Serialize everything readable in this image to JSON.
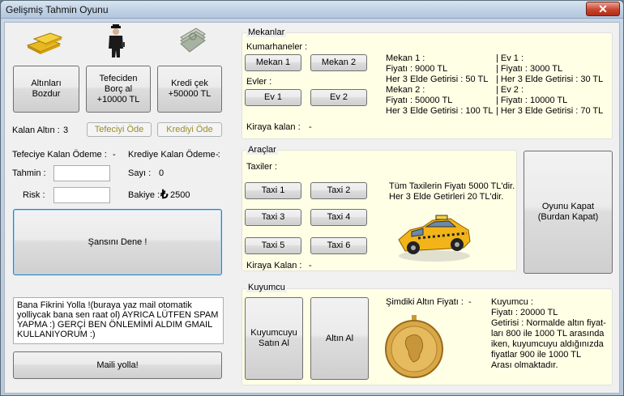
{
  "window": {
    "title": "Gelişmiş Tahmin Oyunu",
    "close_glyph": "✕"
  },
  "left": {
    "buttons": {
      "altin_bozdur": "Altınları\nBozdur",
      "tefeci_borc": "Tefeciden\nBorç al\n+10000 TL",
      "kredi_cek": "Kredi çek\n+50000 TL"
    },
    "kalan_altin_label": "Kalan Altın :",
    "kalan_altin_value": "3",
    "tefeciyi_ode": "Tefeciyi Öde",
    "krediyi_ode": "Krediyi Öde",
    "tefeciye_kalan": "Tefeciye Kalan Ödeme :",
    "tefeciye_kalan_value": "-",
    "krediye_kalan": "Krediye Kalan Ödeme :",
    "krediye_kalan_value": "-",
    "tahmin_label": "Tahmin :",
    "sayi_label": "Sayı :",
    "sayi_value": "0",
    "risk_label": "Risk :",
    "bakiye_label": "Bakiye :",
    "bakiye_symbol": "₺",
    "bakiye_value": "2500",
    "sansini_dene": "Şansını Dene !",
    "feedback_text": "Bana Fikrini Yolla !(buraya yaz mail otomatik yolliycak bana sen raat ol) AYRICA LÜTFEN SPAM YAPMA :) GERÇİ BEN ÖNLEMİMİ ALDIM GMAIL KULLANIYORUM :)",
    "maili_yolla": "Maili yolla!"
  },
  "mekanlar": {
    "legend": "Mekanlar",
    "kumarhaneler": "Kumarhaneler :",
    "mekan1": "Mekan 1",
    "mekan2": "Mekan 2",
    "evler": "Evler :",
    "ev1": "Ev 1",
    "ev2": "Ev 2",
    "kiraya_kalan": "Kiraya kalan :",
    "kiraya_kalan_value": "-",
    "info_mekan": "Mekan 1 :\nFiyatı : 9000 TL\nHer 3 Elde Getirisi :  50 TL\nMekan 2 :\nFiyatı : 50000 TL\nHer 3 Elde Getirisi : 100 TL",
    "info_ev": "| Ev 1 :\n| Fiyatı : 3000 TL\n| Her 3 Elde Getirisi : 30 TL\n| Ev 2 :\n| Fiyatı : 10000 TL\n| Her 3 Elde Getirisi : 70 TL"
  },
  "araclar": {
    "legend": "Araçlar",
    "taxiler": "Taxiler :",
    "taxi": [
      "Taxi 1",
      "Taxi 2",
      "Taxi 3",
      "Taxi 4",
      "Taxi 5",
      "Taxi 6"
    ],
    "info": "Tüm Taxilerin Fiyatı 5000 TL'dir.\nHer 3 Elde Getirleri 20 TL'dir.",
    "kiraya_kalan": "Kiraya Kalan :",
    "kiraya_kalan_value": "-"
  },
  "oyunu_kapat": "Oyunu Kapat\n(Burdan Kapat)",
  "kuyumcu": {
    "legend": "Kuyumcu",
    "satin_al": "Kuyumcuyu\nSatın Al",
    "altin_al": "Altın Al",
    "simdiki_fiyat": "Şimdiki Altın Fiyatı :",
    "simdiki_fiyat_value": "-",
    "info": "Kuyumcu :\nFiyatı : 20000 TL\nGetirisi : Normalde altın fiyat-\nları 800 ile 1000 TL arasında\niken, kuyumcuyu aldığınızda\nfiyatlar 900 ile 1000 TL\nArası olmaktadır."
  },
  "colors": {
    "group_bg": "#ffffe6",
    "disabled_text": "#9a8d2a",
    "focus_border": "#3c7fb1"
  },
  "icons": [
    "gold-bars-icon",
    "loan-shark-icon",
    "money-stack-icon",
    "taxi-car-icon",
    "gold-coin-icon"
  ]
}
